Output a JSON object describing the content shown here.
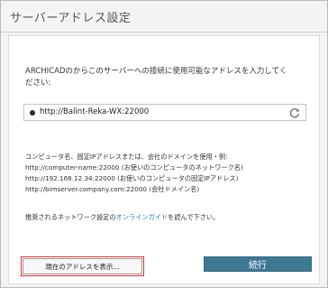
{
  "window": {
    "title": "サーバーアドレス設定"
  },
  "instruction": {
    "line1": "ARCHICADのからこのサーバーへの接続に使用可能なアドレスを入力してく",
    "line2": "ださい:"
  },
  "address_field": {
    "value": "http://Balint-Reka-WX:22000",
    "status_icon": "status-dot-icon",
    "refresh_icon": "refresh-icon"
  },
  "info": {
    "heading": "コンピュータ名、固定IPアドレスまたは、会社のドメインを使用・例:",
    "examples": [
      "http://computer-name:22000 (お使いのコンピュータのネットワーク名)",
      "http://192.168.12.34:22000 (お使いのコンピュータの固定IPアドレス)",
      "http://bimserver.company.com:22000 (会社ドメイン名)"
    ]
  },
  "guide": {
    "prefix": "推奨されるネットワーク設定の",
    "link": "オンラインガイド",
    "suffix": "を読んで下さい。"
  },
  "buttons": {
    "show_address": "現在のアドレスを表示...",
    "continue": "続行"
  },
  "colors": {
    "accent": "#3d7894",
    "link": "#2a73c9",
    "highlight": "#e03030"
  }
}
